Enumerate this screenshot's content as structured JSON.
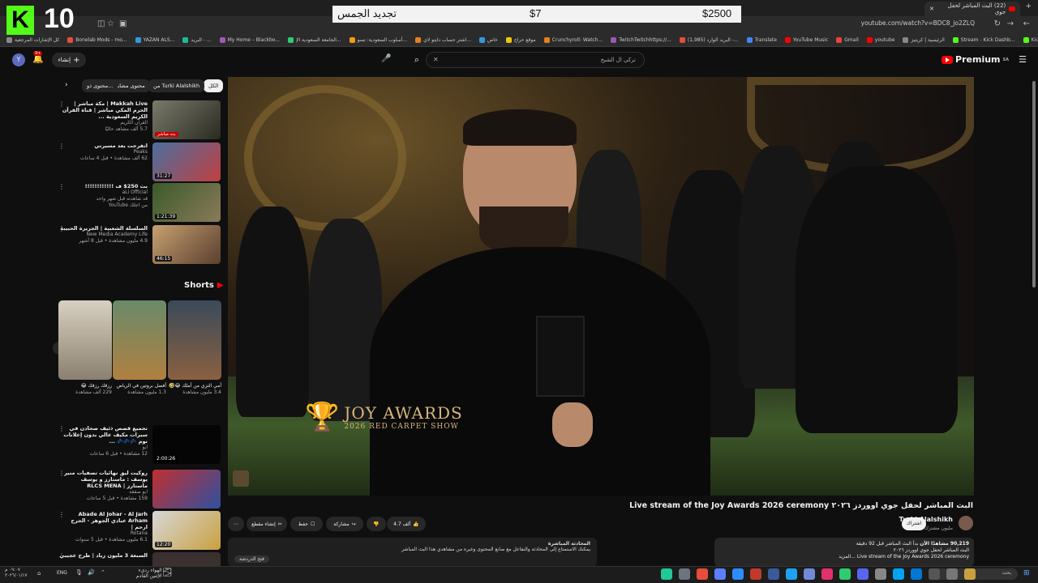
{
  "overlay": {
    "kick_count": "10",
    "donation_left": "$2500",
    "donation_middle": "$7",
    "donation_right": "تجديد الجمس"
  },
  "browser": {
    "tab_title": "(22) البث المباشر لحفل جوي",
    "url": "youtube.com/watch?v=BDC8_jo2ZLQ",
    "bookmarks": [
      "كل الإشارات المرجعية",
      "Bonelab Mods - mo...",
      "YAZAN ALS...",
      "البريد - ...",
      "My Home – Blackbo...",
      "الجامعة السعودية الإ...",
      "أسلوب السعودية: تسو...",
      "اشتر حساب دايتو لاي...",
      "خاص",
      "موقع حراج",
      "Crunchyroll: Watch...",
      "TwitchTwitchhttps://...",
      "(1,985) البريد الوارد -...",
      "Translate",
      "YouTube Music",
      "Gmail",
      "youtube",
      "الرئيسية | كريتيز",
      "Stream - Kick Dashb...",
      "Kick",
      "Google"
    ]
  },
  "yt": {
    "search_value": "تركي ال الشيخ",
    "premium": "Premium",
    "premium_sup": "SA",
    "create": "إنشاء",
    "avatar_letter": "Y",
    "notif_count": "9+"
  },
  "chips": [
    "الكل",
    "من Turki Alalshikh",
    "محتوى مشابه",
    "محتوى ذو..."
  ],
  "video": {
    "title": "البث المباشر لحفل جوي اووردز ٢٠٢٦ Live stream of the Joy Awards 2026 ceremony",
    "channel": "Turki Alalshikh",
    "subs": "3.64 مليون مشترك",
    "subscribe": "اشتراك",
    "likes": "4.7 ألف",
    "share": "مشاركة",
    "save": "حفظ",
    "clip": "إنشاء مقطع",
    "more": "⋯",
    "overlay_brand": "JOY AWARDS",
    "overlay_sub": "2026 RED CARPET SHOW",
    "desc_views": "90,219 مشاهدًا الآن",
    "desc_line1": "بدأ البث المباشر قبل 92 دقيقة",
    "desc_line2": "البث المباشر لحفل جوي اووردز ٢٠٢٦",
    "desc_line3": "Live stream of the Joy Awards 2026 ceremony ...المزيد",
    "chat_title": "المحادثة المباشرة",
    "chat_msg": "يمكنك الاستمتاع إلى المحادثة والتفاعل مع صانع المحتوى وغيره من مشاهدي هذا البث المباشر",
    "chat_open": "فتح الدردشة"
  },
  "sidebar": [
    {
      "title": "Makkah Live | مكة مباشر | الحرم المكي مباشر | قناة القرآن الكريم السعودية ...",
      "channel": "القرآن الكريم",
      "meta": "5.7 ألف مشاهد حاليًا",
      "badge": "بث مباشر"
    },
    {
      "title": "اتفرجت بعد مسيرتي",
      "channel": "Peaks",
      "meta": "62 ألف مشاهدة • قبل 4 ساعات",
      "dur": "31:27"
    },
    {
      "title": "بث 250$ ف !!!!!!!!!!!!",
      "channel": "aLi Official",
      "meta": "قد شاهدته قبل شهر واحد",
      "meta2": "من اجلك YouTube",
      "dur": "1:21:39"
    },
    {
      "title": "السلسلة الشعبية | الجزيرة الحبيبة",
      "channel": "New Media Academy Life",
      "meta": "4.9 مليون مشاهدة • قبل 8 أشهر",
      "dur": "46:15"
    }
  ],
  "shorts": {
    "title": "Shorts",
    "items": [
      {
        "title": "أمي التزي من أملك 😂🤣",
        "views": "3.4 مليون مشاهدة"
      },
      {
        "title": "أفضل بروتين في الرياض",
        "views": "1.3 مليون مشاهدة"
      },
      {
        "title": "رزقك رزقك 😂",
        "views": "229 ألف مشاهدة"
      }
    ]
  },
  "sidebar2": [
    {
      "title": "تجميع قصص ذئيف صحادن في سيرات مكيف عالي بدون إعلانات نوم 💤💤💤 ...",
      "channel": "ابو",
      "meta": "12 مشاهدة • قبل 6 ساعات",
      "dur": "2:00:26"
    },
    {
      "title": "روكيت ليق نهائيات تصفيات منير يوسف : ماستارز و يوسف ماستارز | RLCS MENA",
      "channel": "ابو صفقة",
      "meta": "159 مشاهدة • قبل 5 ساعات"
    },
    {
      "title": "Abade Al Johar - Al Jarh Arham عبادي الجوهر - الجرح ارحم |",
      "channel": "Rotana",
      "meta": "6.1 مليون مشاهدة • قبل 5 سنوات",
      "dur": "12:20"
    },
    {
      "title": "السبعة 3 مليون زياد | طرح عجيبي"
    }
  ],
  "taskbar": {
    "time": "٠٩:٠٧ م",
    "date": "٢٠٢٦/٠١/١٧",
    "lang": "ENG",
    "weather_title": "الهواء رديء",
    "weather_sub": "الإثنين القادم",
    "search": "بحث"
  }
}
